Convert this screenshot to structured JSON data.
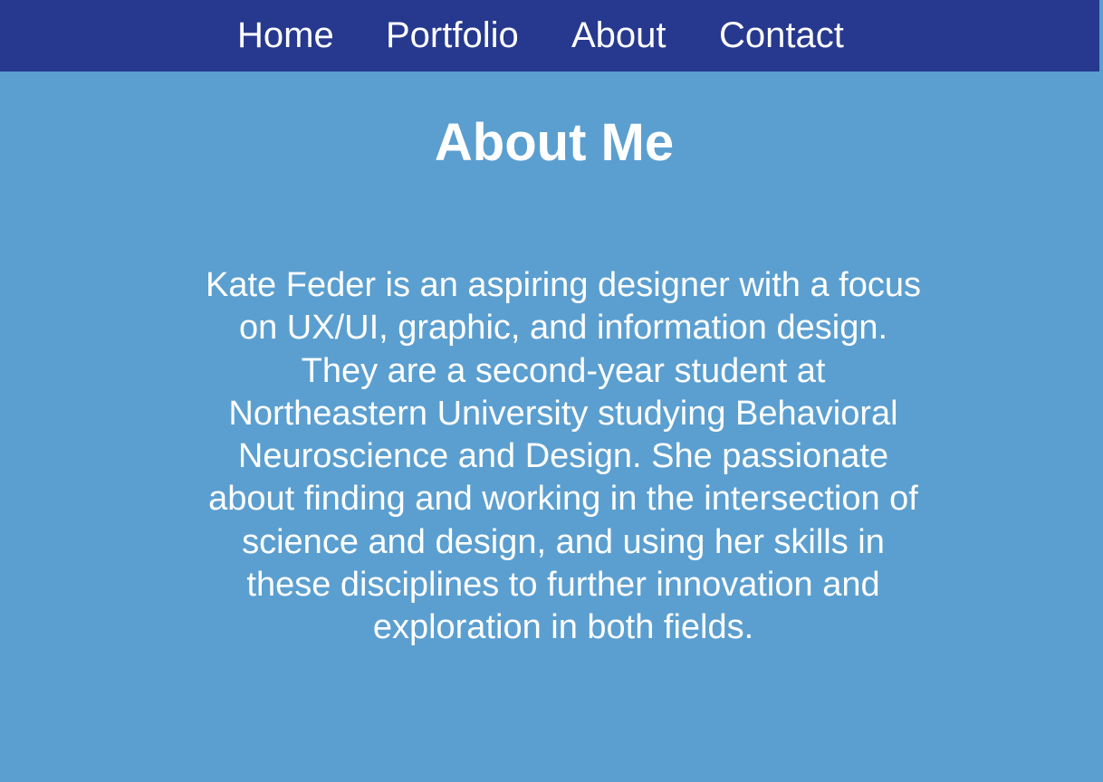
{
  "nav": {
    "items": [
      {
        "label": "Home"
      },
      {
        "label": "Portfolio"
      },
      {
        "label": "About"
      },
      {
        "label": "Contact"
      }
    ]
  },
  "main": {
    "title": "About Me",
    "bio": "Kate Feder is an aspiring designer with a focus on UX/UI, graphic, and information design. They are a second-year student at Northeastern University studying Behavioral Neuroscience and Design. She passionate about finding and working in the intersection of science and design, and using her skills in these disciplines to further innovation and exploration in both fields."
  },
  "colors": {
    "navbar": "#27398e",
    "background": "#5b9fd0",
    "text": "#ffffff"
  }
}
